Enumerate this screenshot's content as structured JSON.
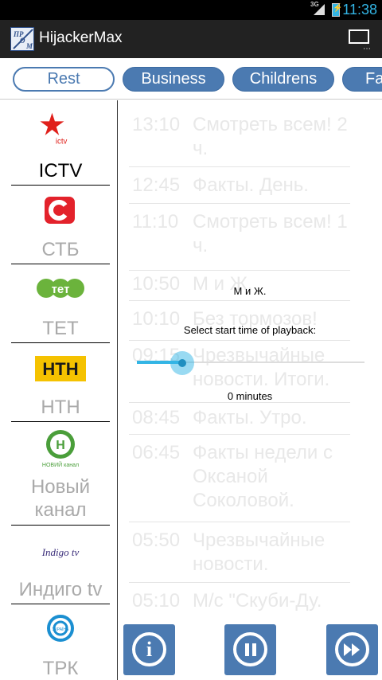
{
  "status_bar": {
    "time": "11:38",
    "network": "3G"
  },
  "app": {
    "title": "HijackerMax",
    "icon_text": [
      "ПР",
      "О",
      "М"
    ]
  },
  "genres": {
    "tabs": [
      {
        "label": "Rest",
        "active": true
      },
      {
        "label": "Business",
        "active": false
      },
      {
        "label": "Childrens",
        "active": false
      },
      {
        "label": "Fa",
        "active": false
      }
    ]
  },
  "channels": [
    {
      "name": "ICTV",
      "logo": "ictv-star-logo",
      "active": true
    },
    {
      "name": "СТБ",
      "logo": "stb-logo",
      "active": false
    },
    {
      "name": "ТЕТ",
      "logo": "tet-logo",
      "active": false
    },
    {
      "name": "НТН",
      "logo": "ntn-logo",
      "active": false
    },
    {
      "name": "Новый канал",
      "logo": "novyi-kanal-logo",
      "active": false
    },
    {
      "name": "Индиго tv",
      "logo": "indigo-tv-logo",
      "active": false
    },
    {
      "name": "ТРК",
      "logo": "trk-ukraina-logo",
      "active": false
    }
  ],
  "channel_logo_text": {
    "ictv": "ictv",
    "tet": "тет",
    "ntn": "НТН",
    "novyi": "НОВИЙ канал",
    "indigo": "Indigo tv",
    "ukraina": "УКРАЇНА"
  },
  "programs": [
    {
      "time": "13:10",
      "title": "Смотреть всем! 2 ч."
    },
    {
      "time": "12:45",
      "title": "Факты. День."
    },
    {
      "time": "11:10",
      "title": "Смотреть всем! 1 ч."
    },
    {
      "time": "10:50",
      "title": "М и Ж."
    },
    {
      "time": "10:10",
      "title": "Без тормозов!"
    },
    {
      "time": "09:15",
      "title": "Чрезвычайные новости. Итоги."
    },
    {
      "time": "08:45",
      "title": "Факты. Утро."
    },
    {
      "time": "06:45",
      "title": "Факты недели с Оксаной Соколовой."
    },
    {
      "time": "05:50",
      "title": "Чрезвычайные новости."
    },
    {
      "time": "05:10",
      "title": "М/с \"Скуби-Ду."
    }
  ],
  "playback_dialog": {
    "title": "М и Ж.",
    "label": "Select start time of playback:",
    "value_text": "0 minutes",
    "slider_fraction": 0.2,
    "accent_color": "#33b5e5"
  },
  "controls": {
    "info": {
      "icon": "info-icon",
      "glyph": "i"
    },
    "pause": {
      "icon": "pause-icon"
    },
    "forward": {
      "icon": "fast-forward-icon"
    }
  },
  "colors": {
    "tab_blue": "#4b7ab1",
    "action_bar": "#222222",
    "status_accent": "#33b5e5"
  }
}
